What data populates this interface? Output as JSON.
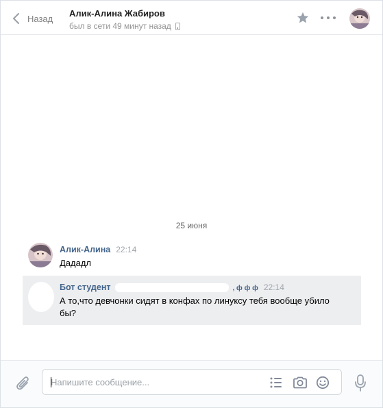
{
  "header": {
    "back_label": "Назад",
    "peer_name": "Алик-Алина Жабиров",
    "peer_status": "был в сети 49 минут назад"
  },
  "date_separator": "25 июня",
  "messages": [
    {
      "author": "Алик-Алина",
      "time": "22:14",
      "text": "Дададл"
    },
    {
      "author": "Бот студент",
      "author_suffix": ", ф ф ф",
      "time": "22:14",
      "text": "А то,что девчонки сидят в конфах по линуксу тебя вообще убило бы?"
    }
  ],
  "composer": {
    "placeholder": "Напишите сообщение..."
  },
  "icons": {
    "back": "chevron-left-icon",
    "star": "star-icon",
    "more": "more-horizontal-icon",
    "attach": "paperclip-icon",
    "template": "list-icon",
    "camera": "camera-icon",
    "emoji": "smile-icon",
    "mic": "microphone-icon",
    "online_device": "phone-icon"
  },
  "colors": {
    "accent_name": "#42648b",
    "selected_message_bg": "#edeef0",
    "icon_gray": "#8f9399"
  }
}
